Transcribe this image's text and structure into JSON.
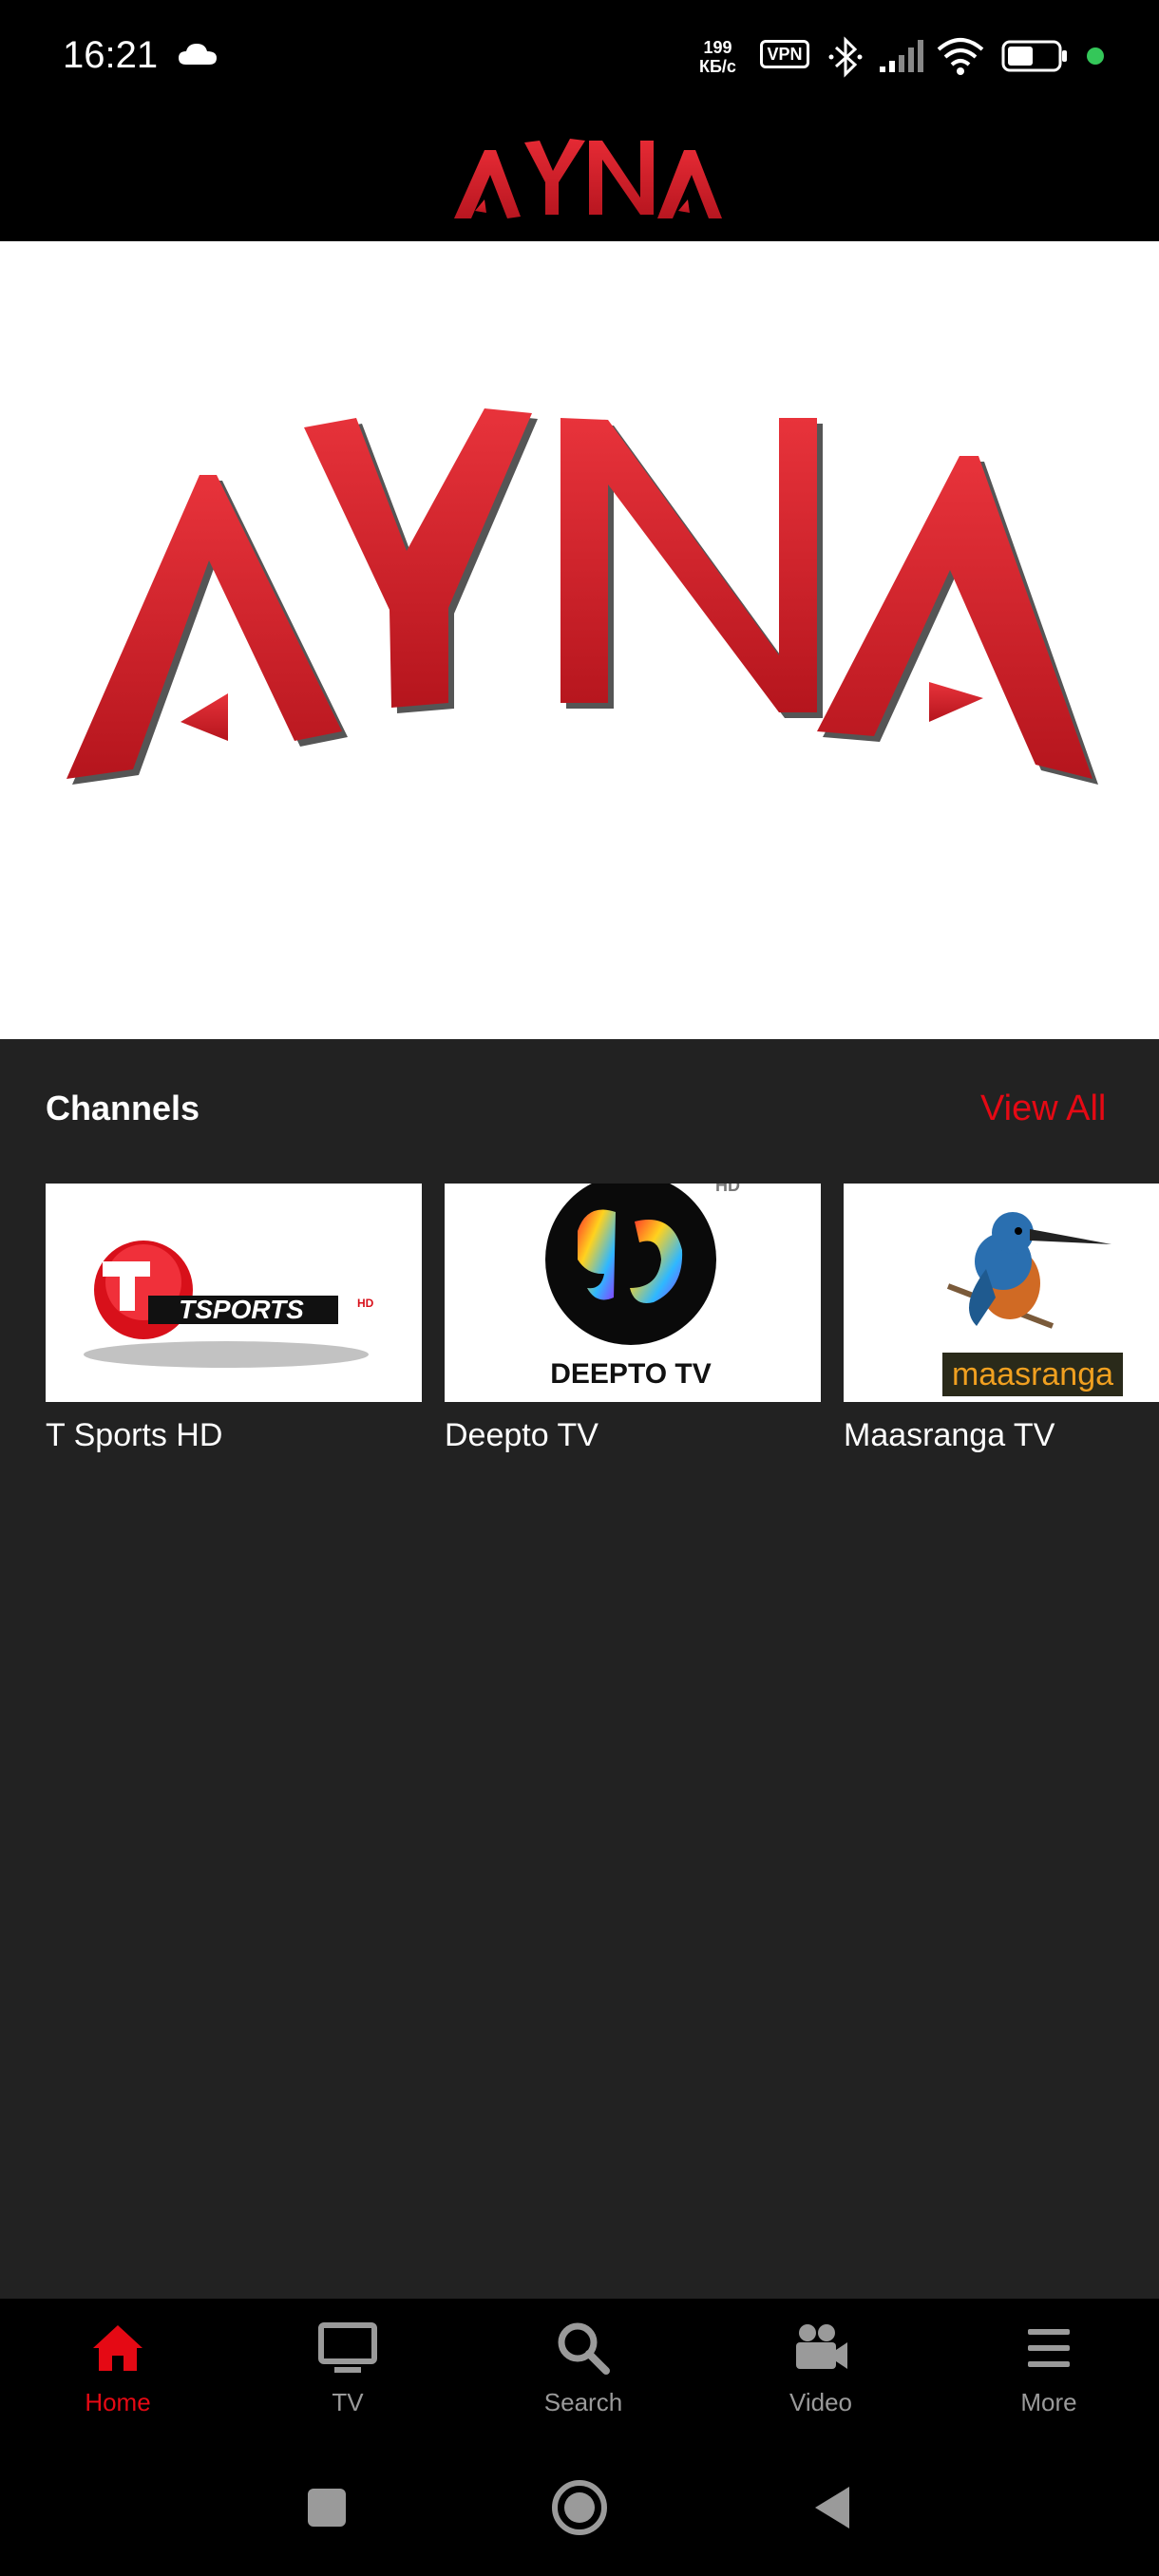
{
  "status_bar": {
    "time": "16:21",
    "speed_value": "199",
    "speed_unit": "КБ/с",
    "vpn": "VPN",
    "icons": [
      "cloud-icon",
      "vpn-icon",
      "bluetooth-icon",
      "signal-icon",
      "wifi-icon",
      "battery-icon"
    ]
  },
  "header": {
    "logo_text": "AYNA",
    "brand_color": "#e0232e"
  },
  "banner": {
    "logo_text": "AYNA"
  },
  "channels": {
    "title": "Channels",
    "view_all": "View All",
    "accent_color": "#e50914",
    "items": [
      {
        "name": "T Sports HD",
        "logo_text": "TSPORTS",
        "logo_badge": "HD"
      },
      {
        "name": "Deepto TV",
        "logo_text": "DEEPTO TV",
        "logo_badge": "HD"
      },
      {
        "name": "Maasranga TV",
        "logo_text": "maasranga"
      }
    ]
  },
  "bottom_nav": {
    "items": [
      {
        "label": "Home",
        "icon": "home-icon",
        "active": true
      },
      {
        "label": "TV",
        "icon": "tv-icon",
        "active": false
      },
      {
        "label": "Search",
        "icon": "search-icon",
        "active": false
      },
      {
        "label": "Video",
        "icon": "video-camera-icon",
        "active": false
      },
      {
        "label": "More",
        "icon": "menu-icon",
        "active": false
      }
    ]
  },
  "system_nav": {
    "items": [
      "recents-icon",
      "home-circle-icon",
      "back-icon"
    ]
  }
}
